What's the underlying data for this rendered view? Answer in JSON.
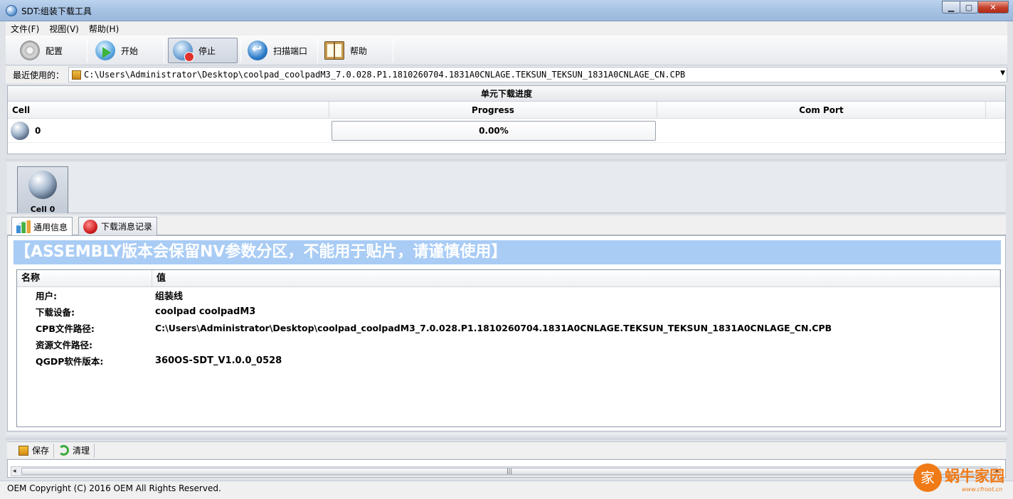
{
  "window": {
    "title": "SDT:组装下载工具",
    "minimize": "▁",
    "maximize": "▢",
    "close": "✕"
  },
  "menu": [
    {
      "label": "文件(F)"
    },
    {
      "label": "视图(V)"
    },
    {
      "label": "帮助(H)"
    }
  ],
  "toolbar": [
    {
      "label": "配置",
      "icon": "gear-icon"
    },
    {
      "label": "开始",
      "icon": "start-icon"
    },
    {
      "label": "停止",
      "icon": "stop-icon",
      "active": true
    },
    {
      "label": "扫描端口",
      "icon": "scan-port-icon"
    },
    {
      "label": "帮助",
      "icon": "help-book-icon"
    }
  ],
  "recent": {
    "label": "最近使用的：",
    "path": "C:\\Users\\Administrator\\Desktop\\coolpad_coolpadM3_7.0.028.P1.1810260704.1831A0CNLAGE.TEKSUN_TEKSUN_1831A0CNLAGE_CN.CPB",
    "dropdown": "▼"
  },
  "cells": {
    "group_header": "单元下载进度",
    "columns": [
      "Cell",
      "Progress",
      "Com Port"
    ],
    "rows": [
      {
        "cell": "0",
        "progress": "0.00%",
        "progress_value": 0,
        "com_port": ""
      }
    ]
  },
  "cell_tab": {
    "label": "Cell 0"
  },
  "info_tabs": [
    {
      "label": "通用信息",
      "active": true
    },
    {
      "label": "下载消息记录",
      "active": false
    }
  ],
  "banner": "【ASSEMBLY版本会保留NV参数分区，不能用于贴片，请谨慎使用】",
  "info_table": {
    "columns": [
      "名称",
      "值"
    ],
    "rows": [
      {
        "key": "用户:",
        "value": "组装线"
      },
      {
        "key": "下载设备:",
        "value": "coolpad coolpadM3"
      },
      {
        "key": "CPB文件路径:",
        "value": "C:\\Users\\Administrator\\Desktop\\coolpad_coolpadM3_7.0.028.P1.1810260704.1831A0CNLAGE.TEKSUN_TEKSUN_1831A0CNLAGE_CN.CPB"
      },
      {
        "key": "资源文件路径:",
        "value": ""
      },
      {
        "key": "QGDP软件版本:",
        "value": "360OS-SDT_V1.0.0_0528"
      }
    ]
  },
  "log_toolbar": {
    "save": "保存",
    "clear": "清理"
  },
  "scrollbar": {
    "left": "◂",
    "grip": "|||",
    "right": "▸"
  },
  "status": "OEM Copyright (C) 2016 OEM All Rights Reserved.",
  "watermark": {
    "glyph": "家",
    "text": "蜗牛家园",
    "url": "www.cfroot.cn"
  },
  "colors": {
    "banner": "#a9ccf5",
    "title_bar": "#a8c3e4",
    "watermark": "#f07a16"
  }
}
